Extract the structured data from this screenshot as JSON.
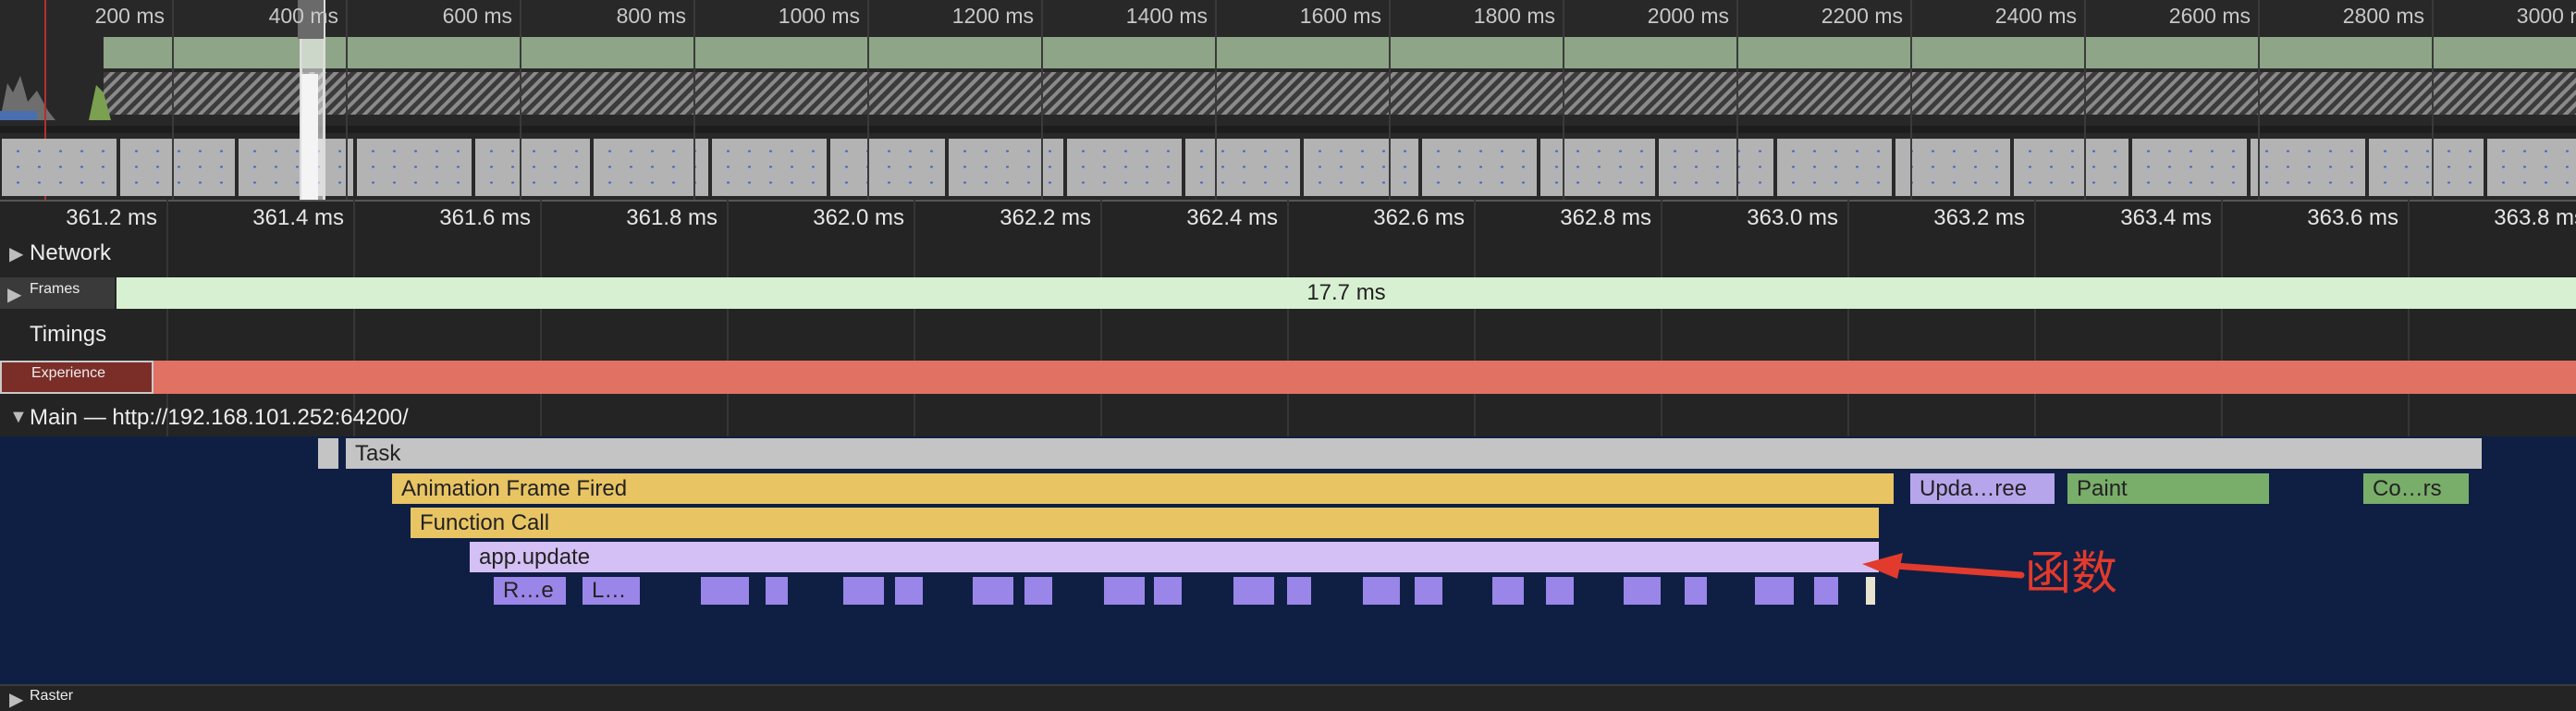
{
  "overview": {
    "time_labels": [
      "200 ms",
      "400 ms",
      "600 ms",
      "800 ms",
      "1000 ms",
      "1200 ms",
      "1400 ms",
      "1600 ms",
      "1800 ms",
      "2000 ms",
      "2200 ms",
      "2400 ms",
      "2600 ms",
      "2800 ms",
      "3000 ms"
    ]
  },
  "ruler": {
    "labels": [
      "361.2 ms",
      "361.4 ms",
      "361.6 ms",
      "361.8 ms",
      "362.0 ms",
      "362.2 ms",
      "362.4 ms",
      "362.6 ms",
      "362.8 ms",
      "363.0 ms",
      "363.2 ms",
      "363.4 ms",
      "363.6 ms",
      "363.8 ms"
    ]
  },
  "tracks": {
    "network": "Network",
    "frames": "Frames",
    "frame_duration": "17.7 ms",
    "timings": "Timings",
    "experience": "Experience",
    "main": "Main — http://192.168.101.252:64200/",
    "raster": "Raster"
  },
  "flame": {
    "task": "Task",
    "animation_frame": "Animation Frame Fired",
    "function_call": "Function Call",
    "app_update": "app.update",
    "update_tree": "Upda…ree",
    "paint": "Paint",
    "composite": "Co…rs",
    "child_r": "R…e",
    "child_l": "L…"
  },
  "annotation": {
    "text": "函数",
    "color": "#e23a2c"
  },
  "colors": {
    "task": "#c4c4c4",
    "scripting": "#e8c463",
    "js_function": "#d4c0f4",
    "rendering": "#9a86e8",
    "painting": "#79ad6a",
    "experience": "#e17263",
    "frames": "#d8f0d2",
    "flame_bg": "#0f1f44"
  }
}
